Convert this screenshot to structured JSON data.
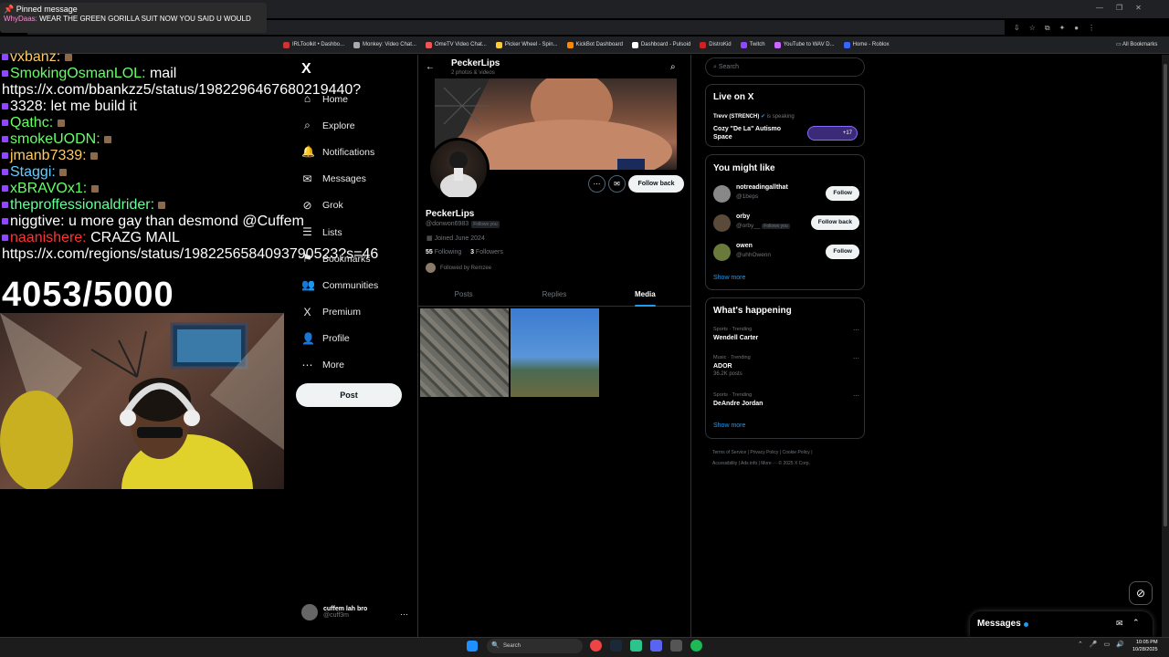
{
  "pinned": {
    "header": "Pinned message",
    "user": "WhyDaas:",
    "text": "WEAR THE GREEN GORILLA SUIT NOW YOU SAID U WOULD"
  },
  "chat": [
    {
      "user": "vxbanz:",
      "color": "#ffcc66",
      "msg": ""
    },
    {
      "user": "SmokingOsmanLOL:",
      "color": "#66ff66",
      "msg": "mail"
    },
    {
      "user": "",
      "color": "#fff",
      "msg": "https://x.com/bbankzz5/status/1982296467680219440?"
    },
    {
      "user": "3328:",
      "color": "#fff",
      "msg": "let me build it"
    },
    {
      "user": "Qathc:",
      "color": "#66ff66",
      "msg": ""
    },
    {
      "user": "smokeUODN:",
      "color": "#66ff66",
      "msg": ""
    },
    {
      "user": "jmanb7339:",
      "color": "#ffcc66",
      "msg": ""
    },
    {
      "user": "Staggi:",
      "color": "#66ccff",
      "msg": ""
    },
    {
      "user": "xBRAVOx1:",
      "color": "#66ff66",
      "msg": ""
    },
    {
      "user": "theproffessionaldrider:",
      "color": "#66ff99",
      "msg": ""
    },
    {
      "user": "niggtive:",
      "color": "#fff",
      "msg": "u more gay than desmond @Cuffem"
    },
    {
      "user": "naanishere:",
      "color": "#ff3333",
      "msg": "CRAZG MAIL"
    },
    {
      "user": "",
      "color": "#fff",
      "msg": "https://x.com/regions/status/1982256584093790523?s=46"
    }
  ],
  "counter": "4053/5000",
  "bookmarks": [
    "IRLToolkit • Dashbo...",
    "Monkey: Video Chat...",
    "OmeTV Video Chat...",
    "Picker Wheel - Spin...",
    "KickBot Dashboard",
    "Dashboard - Pulsoid",
    "DistroKid",
    "Twitch",
    "YouTube to WAV D...",
    "Home - Roblox"
  ],
  "all_bookmarks": "All Bookmarks",
  "nav": {
    "logo": "X",
    "items": [
      {
        "label": "Home",
        "icon": "⌂"
      },
      {
        "label": "Explore",
        "icon": "⌕"
      },
      {
        "label": "Notifications",
        "icon": "🔔"
      },
      {
        "label": "Messages",
        "icon": "✉"
      },
      {
        "label": "Grok",
        "icon": "⊘"
      },
      {
        "label": "Lists",
        "icon": "☰"
      },
      {
        "label": "Bookmarks",
        "icon": "⚑"
      },
      {
        "label": "Communities",
        "icon": "👥"
      },
      {
        "label": "Premium",
        "icon": "X"
      },
      {
        "label": "Profile",
        "icon": "👤"
      },
      {
        "label": "More",
        "icon": "⋯"
      }
    ],
    "post": "Post",
    "account": {
      "name": "cuffem lah bro",
      "handle": "@cuff3m"
    }
  },
  "profile": {
    "title": "PeckerLips",
    "subtitle": "2 photos & videos",
    "name": "PeckerLips",
    "handle": "@donwon6983",
    "follows_you": "Follows you",
    "joined": "Joined June 2024",
    "following_count": "55",
    "following_label": "Following",
    "followers_count": "3",
    "followers_label": "Followers",
    "followed_by": "Followed by Remzee",
    "follow_back": "Follow back",
    "tabs": [
      "Posts",
      "Replies",
      "Media"
    ],
    "active_tab": "Media"
  },
  "right": {
    "search_placeholder": "Search",
    "live": {
      "title": "Live on X",
      "host": "Trevv (STRENCH)",
      "speaking": "is speaking",
      "space": "Cozy \"De La\" Autismo Space",
      "count": "+17"
    },
    "wtf": {
      "title": "You might like",
      "users": [
        {
          "name": "notreadingallthat",
          "handle": "@1beps",
          "btn": "Follow",
          "fy": ""
        },
        {
          "name": "orby",
          "handle": "@orby__",
          "btn": "Follow back",
          "fy": "Follows you"
        },
        {
          "name": "owen",
          "handle": "@uhhOwenn",
          "btn": "Follow",
          "fy": ""
        }
      ],
      "show_more": "Show more"
    },
    "happening": {
      "title": "What's happening",
      "trends": [
        {
          "cat": "Sports · Trending",
          "title": "Wendell Carter",
          "posts": ""
        },
        {
          "cat": "Music · Trending",
          "title": "ADOR",
          "posts": "36.2K posts"
        },
        {
          "cat": "Sports · Trending",
          "title": "DeAndre Jordan",
          "posts": ""
        }
      ],
      "show_more": "Show more"
    },
    "footer": [
      "Terms of Service",
      "Privacy Policy",
      "Cookie Policy",
      "Accessibility",
      "Ads info",
      "More ···",
      "© 2025 X Corp."
    ]
  },
  "messages_drawer": "Messages",
  "taskbar": {
    "search": "Search",
    "time": "10:05 PM",
    "date": "10/28/2025"
  }
}
